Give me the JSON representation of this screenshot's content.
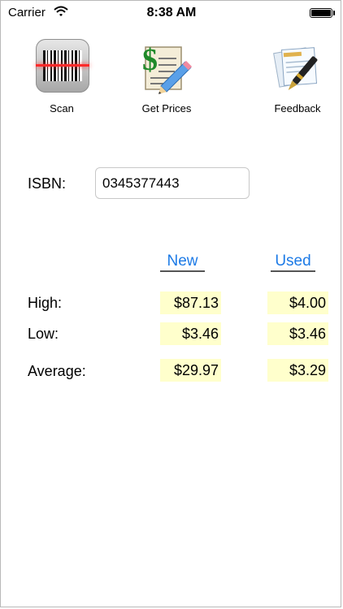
{
  "status_bar": {
    "carrier": "Carrier",
    "time": "8:38 AM"
  },
  "toolbar": {
    "items": [
      {
        "label": "Scan",
        "icon": "barcode-scanner-icon"
      },
      {
        "label": "Get Prices",
        "icon": "price-list-icon"
      },
      {
        "label": "Feedback",
        "icon": "feedback-pen-icon"
      }
    ]
  },
  "isbn": {
    "label": "ISBN:",
    "value": "0345377443"
  },
  "prices": {
    "columns": [
      "New",
      "Used"
    ],
    "rows": [
      {
        "label": "High:",
        "new": "$87.13",
        "used": "$4.00"
      },
      {
        "label": "Low:",
        "new": "$3.46",
        "used": "$3.46"
      },
      {
        "label": "Average:",
        "new": "$29.97",
        "used": "$3.29"
      }
    ]
  },
  "colors": {
    "link_blue": "#1c7ae6",
    "cell_highlight": "#ffffcc"
  }
}
